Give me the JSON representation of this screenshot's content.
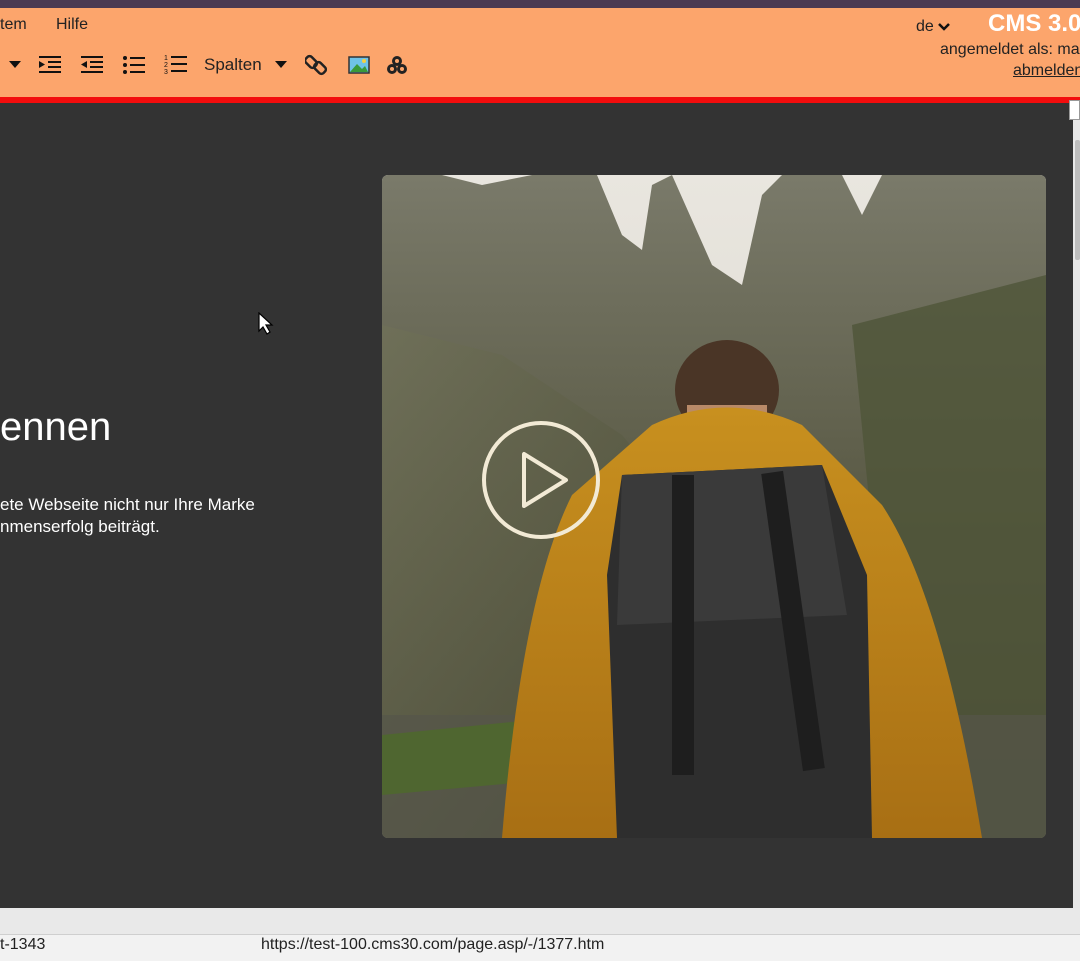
{
  "cms_bar": {
    "menu": [
      "tem",
      "Hilfe"
    ],
    "columns_label": "Spalten",
    "language": "de",
    "brand": "CMS 3.0",
    "login_text": "angemeldet als: ma",
    "logout_label": "abmelden",
    "colors": {
      "bar": "#fca56c",
      "accent_line": "#f20d0d"
    }
  },
  "page": {
    "heading": "ennen",
    "body_lines": [
      "ete Webseite nicht nur Ihre Marke",
      "nmenserfolg beiträgt."
    ]
  },
  "status": {
    "left": "t-1343",
    "url": "https://test-100.cms30.com/page.asp/-/1377.htm"
  },
  "icons": {
    "toolbar": [
      "dropdown-arrow-icon",
      "indent-icon",
      "outdent-icon",
      "bullet-list-icon",
      "numbered-list-icon",
      "columns-dropdown-icon",
      "link-icon",
      "image-icon",
      "plugin-icon"
    ],
    "video": "play-icon"
  }
}
